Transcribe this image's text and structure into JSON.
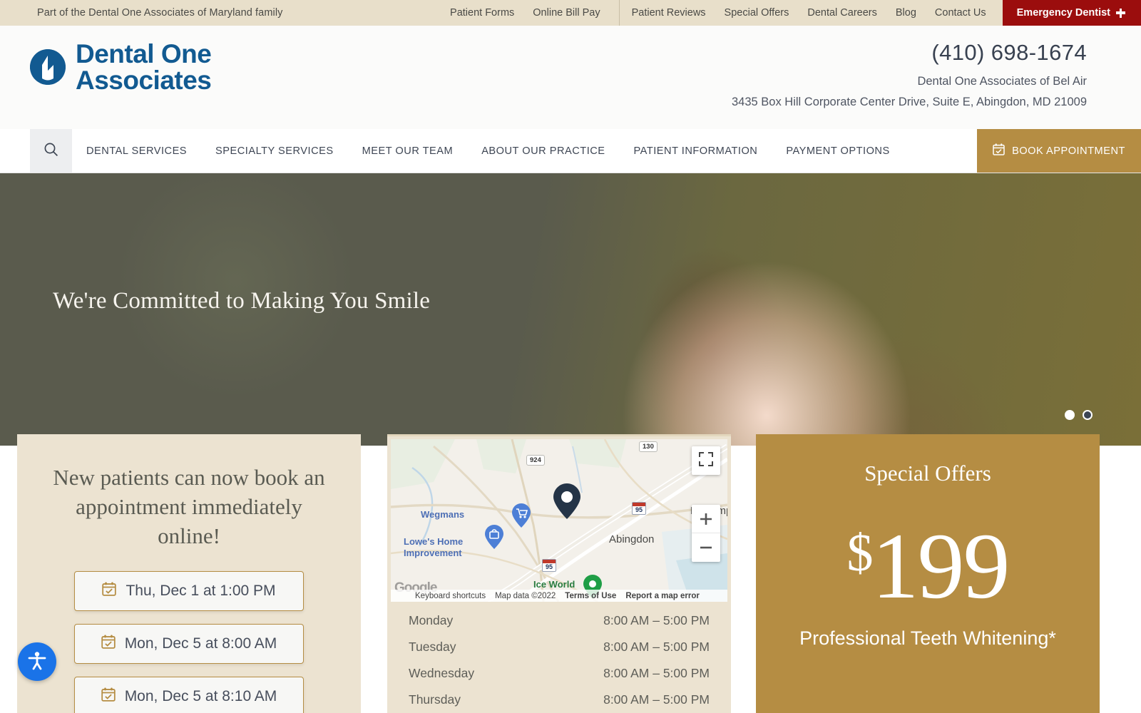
{
  "topbar": {
    "tagline": "Part of the Dental One Associates of Maryland family",
    "links_group1": [
      {
        "label": "Patient Forms"
      },
      {
        "label": "Online Bill Pay"
      }
    ],
    "links_group2": [
      {
        "label": "Patient Reviews"
      },
      {
        "label": "Special Offers"
      },
      {
        "label": "Dental Careers"
      },
      {
        "label": "Blog"
      },
      {
        "label": "Contact Us"
      }
    ],
    "emergency_label": "Emergency Dentist",
    "emergency_icon": "medical-cross-icon",
    "emergency_color": "#9b0d0d"
  },
  "header": {
    "logo_line1": "Dental One",
    "logo_line2": "Associates",
    "logo_icon": "dental-one-logo-icon",
    "logo_color": "#125a91",
    "phone": "(410) 698-1674",
    "practice_name": "Dental One Associates of Bel Air",
    "address": "3435 Box Hill Corporate Center Drive, Suite E, Abingdon, MD 21009"
  },
  "nav": {
    "search_icon": "search-icon",
    "items": [
      {
        "label": "DENTAL SERVICES"
      },
      {
        "label": "SPECIALTY SERVICES"
      },
      {
        "label": "MEET OUR TEAM"
      },
      {
        "label": "ABOUT OUR PRACTICE"
      },
      {
        "label": "PATIENT INFORMATION"
      },
      {
        "label": "PAYMENT OPTIONS"
      }
    ],
    "book_label": "BOOK APPOINTMENT",
    "book_icon": "calendar-check-icon",
    "book_color": "#b58d43"
  },
  "hero": {
    "headline": "We're Committed to Making You Smile",
    "dots": [
      {
        "state": "inactive"
      },
      {
        "state": "active"
      }
    ]
  },
  "booking_card": {
    "title": "New patients can now book an appointment immediately online!",
    "slots": [
      {
        "label": "Thu, Dec 1 at 1:00 PM",
        "icon": "calendar-check-icon"
      },
      {
        "label": "Mon, Dec 5 at 8:00 AM",
        "icon": "calendar-check-icon"
      },
      {
        "label": "Mon, Dec 5 at 8:10 AM",
        "icon": "calendar-check-icon"
      }
    ]
  },
  "map_card": {
    "labels": [
      {
        "text": "Wegmans"
      },
      {
        "text": "Lowe's Home"
      },
      {
        "text": "Improvement"
      },
      {
        "text": "Abingdon"
      },
      {
        "text": "Ice World"
      },
      {
        "text": "Belcamp"
      }
    ],
    "route_shields": [
      "924",
      "130"
    ],
    "interstate_shields": [
      "95",
      "95"
    ],
    "watermark": "Google",
    "attribution": {
      "keyboard": "Keyboard shortcuts",
      "mapdata": "Map data ©2022",
      "terms": "Terms of Use",
      "report": "Report a map error"
    },
    "controls": {
      "fullscreen_icon": "fullscreen-icon",
      "zoom_in_icon": "plus-icon",
      "zoom_out_icon": "minus-icon"
    },
    "hours": [
      {
        "day": "Monday",
        "time": "8:00 AM – 5:00 PM"
      },
      {
        "day": "Tuesday",
        "time": "8:00 AM – 5:00 PM"
      },
      {
        "day": "Wednesday",
        "time": "8:00 AM – 5:00 PM"
      },
      {
        "day": "Thursday",
        "time": "8:00 AM – 5:00 PM"
      }
    ]
  },
  "offers_card": {
    "title": "Special Offers",
    "currency": "$",
    "price": "199",
    "subtitle": "Professional Teeth Whitening*",
    "background": "#b58d43"
  },
  "accessibility": {
    "icon": "accessibility-person-icon",
    "color": "#1a73e8"
  }
}
